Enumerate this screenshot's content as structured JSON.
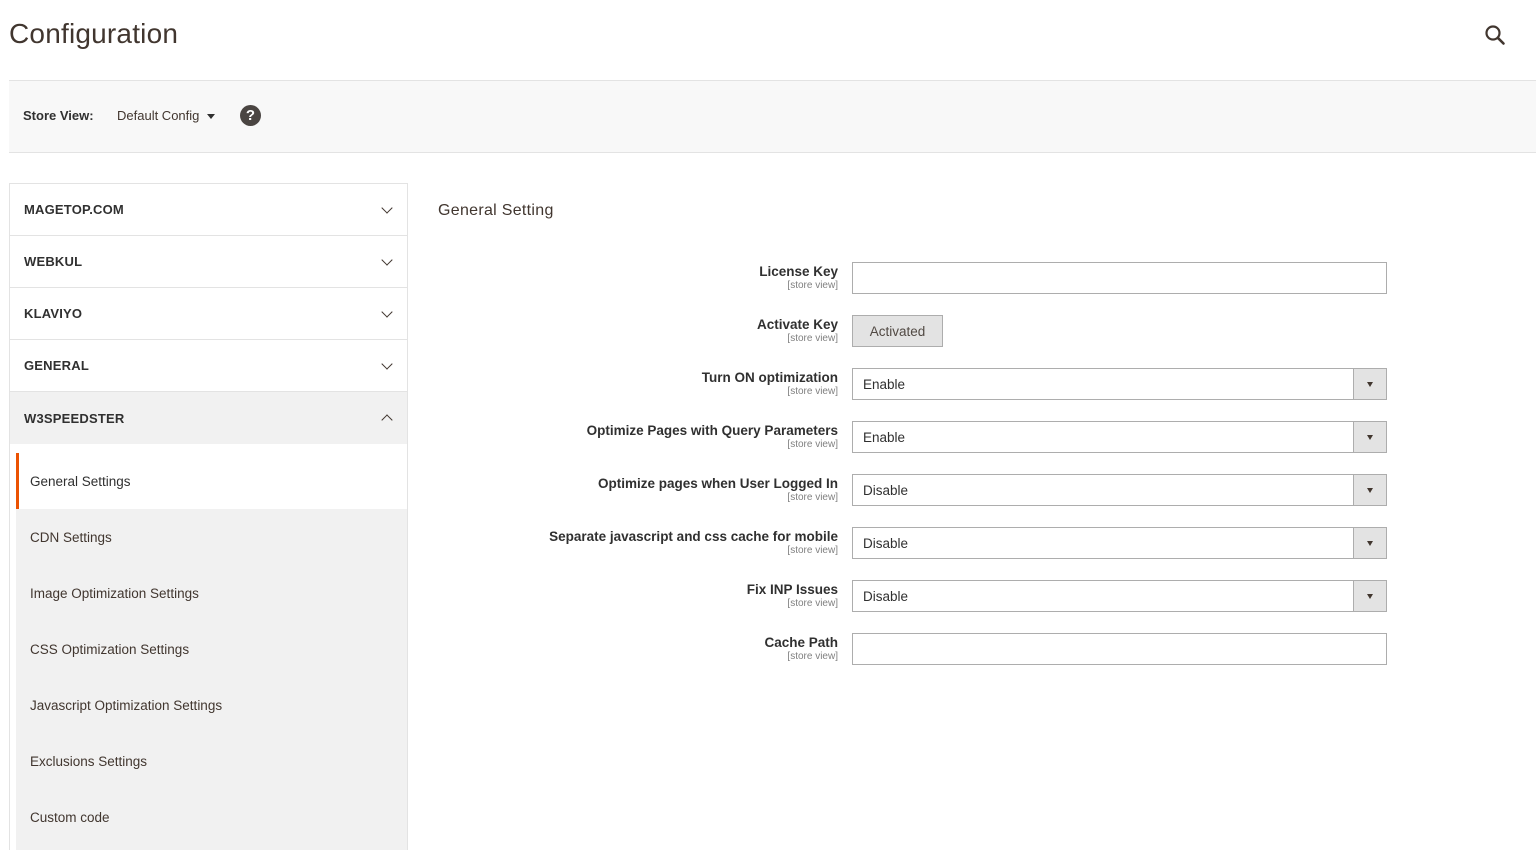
{
  "header": {
    "title": "Configuration",
    "search_icon": "search-icon"
  },
  "scope": {
    "label": "Store View:",
    "selected": "Default Config",
    "help_icon": "question-circle-icon",
    "help_glyph": "?"
  },
  "sidebar": {
    "sections": [
      {
        "label": "MAGETOP.COM",
        "expanded": false
      },
      {
        "label": "WEBKUL",
        "expanded": false
      },
      {
        "label": "KLAVIYO",
        "expanded": false
      },
      {
        "label": "GENERAL",
        "expanded": false
      },
      {
        "label": "W3SPEEDSTER",
        "expanded": true
      }
    ],
    "sub_items": [
      {
        "label": "General Settings",
        "active": true
      },
      {
        "label": "CDN Settings",
        "active": false
      },
      {
        "label": "Image Optimization Settings",
        "active": false
      },
      {
        "label": "CSS Optimization Settings",
        "active": false
      },
      {
        "label": "Javascript Optimization Settings",
        "active": false
      },
      {
        "label": "Exclusions Settings",
        "active": false
      },
      {
        "label": "Custom code",
        "active": false
      }
    ],
    "accent_color": "#eb5202"
  },
  "main": {
    "section_title": "General Setting",
    "fields": [
      {
        "label": "License Key",
        "scope": "[store view]",
        "type": "text",
        "value": ""
      },
      {
        "label": "Activate Key",
        "scope": "[store view]",
        "type": "button",
        "value": "Activated"
      },
      {
        "label": "Turn ON optimization",
        "scope": "[store view]",
        "type": "select",
        "value": "Enable"
      },
      {
        "label": "Optimize Pages with Query Parameters",
        "scope": "[store view]",
        "type": "select",
        "value": "Enable"
      },
      {
        "label": "Optimize pages when User Logged In",
        "scope": "[store view]",
        "type": "select",
        "value": "Disable"
      },
      {
        "label": "Separate javascript and css cache for mobile",
        "scope": "[store view]",
        "type": "select",
        "value": "Disable"
      },
      {
        "label": "Fix INP Issues",
        "scope": "[store view]",
        "type": "select",
        "value": "Disable"
      },
      {
        "label": "Cache Path",
        "scope": "[store view]",
        "type": "text",
        "value": ""
      }
    ]
  }
}
